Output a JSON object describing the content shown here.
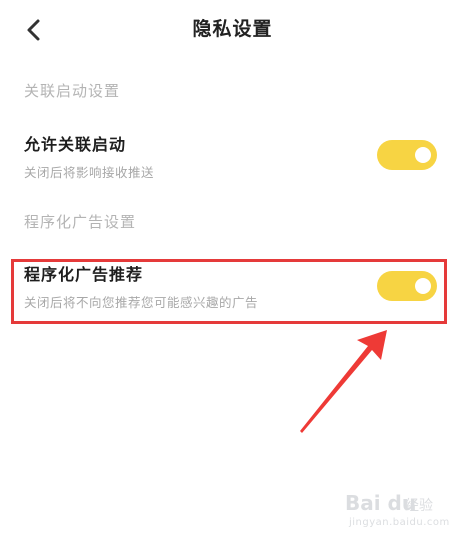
{
  "header": {
    "back_icon": "chevron-left-icon",
    "title": "隐私设置"
  },
  "sections": [
    {
      "header": "关联启动设置",
      "items": [
        {
          "title": "允许关联启动",
          "description": "关闭后将影响接收推送",
          "enabled": true
        }
      ]
    },
    {
      "header": "程序化广告设置",
      "items": [
        {
          "title": "程序化广告推荐",
          "description": "关闭后将不向您推荐您可能感兴趣的广告",
          "enabled": true
        }
      ]
    }
  ],
  "colors": {
    "toggle_on": "#f7d443",
    "highlight": "#e53a3a",
    "section_header": "#b4b4b4",
    "description": "#a8a8a8"
  },
  "watermark": {
    "logo": "Bai du",
    "text": "经验",
    "sub": "jingyan.baidu.com"
  }
}
